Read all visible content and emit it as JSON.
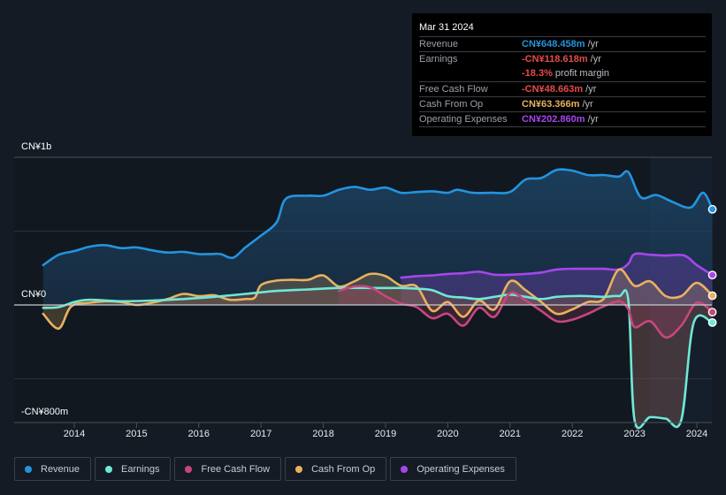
{
  "tooltip": {
    "date": "Mar 31 2024",
    "rows": [
      {
        "label": "Revenue",
        "value": "CN¥648.458m",
        "unit": " /yr",
        "color": "#2394df"
      },
      {
        "label": "Earnings",
        "value": "-CN¥118.618m",
        "unit": " /yr",
        "color": "#e64b4b"
      },
      {
        "label": "",
        "value": "-18.3%",
        "unit": " profit margin",
        "color": "#e64b4b"
      },
      {
        "label": "Free Cash Flow",
        "value": "-CN¥48.663m",
        "unit": " /yr",
        "color": "#e64b4b"
      },
      {
        "label": "Cash From Op",
        "value": "CN¥63.366m",
        "unit": " /yr",
        "color": "#e9b15f"
      },
      {
        "label": "Operating Expenses",
        "value": "CN¥202.860m",
        "unit": " /yr",
        "color": "#a745ee"
      }
    ]
  },
  "legend": [
    {
      "label": "Revenue",
      "color": "#2394df"
    },
    {
      "label": "Earnings",
      "color": "#6ee8d6"
    },
    {
      "label": "Free Cash Flow",
      "color": "#c8467e"
    },
    {
      "label": "Cash From Op",
      "color": "#e9b15f"
    },
    {
      "label": "Operating Expenses",
      "color": "#a745ee"
    }
  ],
  "chart_data": {
    "type": "line",
    "title": "",
    "xlabel": "",
    "ylabel": "",
    "y_tick_labels": [
      "CN¥1b",
      "CN¥0",
      "-CN¥800m"
    ],
    "x_tick_labels": [
      "2014",
      "2015",
      "2016",
      "2017",
      "2018",
      "2019",
      "2020",
      "2021",
      "2022",
      "2023",
      "2024"
    ],
    "xlim": [
      2013.5,
      2024.25
    ],
    "ylim": [
      -800,
      1000
    ],
    "units": "CN¥m",
    "grid": true,
    "legend_position": "bottom",
    "highlight_from": 2023.25,
    "series": [
      {
        "name": "Revenue",
        "color": "#2394df",
        "points": [
          [
            2013.5,
            270
          ],
          [
            2013.75,
            340
          ],
          [
            2014.0,
            365
          ],
          [
            2014.25,
            395
          ],
          [
            2014.5,
            405
          ],
          [
            2014.75,
            385
          ],
          [
            2015.0,
            390
          ],
          [
            2015.25,
            370
          ],
          [
            2015.5,
            355
          ],
          [
            2015.75,
            360
          ],
          [
            2016.0,
            345
          ],
          [
            2016.2,
            345
          ],
          [
            2016.35,
            345
          ],
          [
            2016.55,
            320
          ],
          [
            2016.75,
            390
          ],
          [
            2017.0,
            470
          ],
          [
            2017.25,
            560
          ],
          [
            2017.4,
            720
          ],
          [
            2017.75,
            740
          ],
          [
            2018.0,
            740
          ],
          [
            2018.25,
            780
          ],
          [
            2018.5,
            800
          ],
          [
            2018.75,
            780
          ],
          [
            2019.0,
            795
          ],
          [
            2019.25,
            760
          ],
          [
            2019.5,
            765
          ],
          [
            2019.75,
            770
          ],
          [
            2020.0,
            760
          ],
          [
            2020.15,
            780
          ],
          [
            2020.4,
            760
          ],
          [
            2020.7,
            760
          ],
          [
            2021.0,
            765
          ],
          [
            2021.25,
            850
          ],
          [
            2021.5,
            860
          ],
          [
            2021.75,
            915
          ],
          [
            2022.0,
            910
          ],
          [
            2022.25,
            880
          ],
          [
            2022.5,
            880
          ],
          [
            2022.75,
            870
          ],
          [
            2022.9,
            900
          ],
          [
            2023.1,
            730
          ],
          [
            2023.35,
            745
          ],
          [
            2023.6,
            700
          ],
          [
            2023.9,
            660
          ],
          [
            2024.1,
            760
          ],
          [
            2024.25,
            648
          ]
        ]
      },
      {
        "name": "Operating Expenses",
        "color": "#a745ee",
        "points": [
          [
            2019.25,
            185
          ],
          [
            2019.5,
            195
          ],
          [
            2019.75,
            200
          ],
          [
            2020.0,
            210
          ],
          [
            2020.25,
            215
          ],
          [
            2020.5,
            225
          ],
          [
            2020.75,
            205
          ],
          [
            2021.0,
            205
          ],
          [
            2021.25,
            210
          ],
          [
            2021.5,
            220
          ],
          [
            2021.75,
            240
          ],
          [
            2022.0,
            245
          ],
          [
            2022.25,
            245
          ],
          [
            2022.5,
            245
          ],
          [
            2022.75,
            240
          ],
          [
            2022.9,
            280
          ],
          [
            2023.0,
            345
          ],
          [
            2023.25,
            340
          ],
          [
            2023.5,
            335
          ],
          [
            2023.8,
            335
          ],
          [
            2024.0,
            270
          ],
          [
            2024.25,
            203
          ]
        ]
      },
      {
        "name": "Cash From Op",
        "color": "#e9b15f",
        "points": [
          [
            2013.5,
            -60
          ],
          [
            2013.75,
            -160
          ],
          [
            2013.95,
            -10
          ],
          [
            2014.25,
            15
          ],
          [
            2014.5,
            25
          ],
          [
            2014.75,
            20
          ],
          [
            2015.0,
            0
          ],
          [
            2015.25,
            15
          ],
          [
            2015.5,
            40
          ],
          [
            2015.75,
            75
          ],
          [
            2016.0,
            60
          ],
          [
            2016.25,
            65
          ],
          [
            2016.5,
            35
          ],
          [
            2016.75,
            40
          ],
          [
            2016.9,
            50
          ],
          [
            2017.0,
            135
          ],
          [
            2017.25,
            165
          ],
          [
            2017.5,
            170
          ],
          [
            2017.75,
            170
          ],
          [
            2018.0,
            200
          ],
          [
            2018.25,
            125
          ],
          [
            2018.5,
            160
          ],
          [
            2018.75,
            210
          ],
          [
            2019.0,
            195
          ],
          [
            2019.25,
            130
          ],
          [
            2019.5,
            125
          ],
          [
            2019.75,
            -40
          ],
          [
            2020.0,
            20
          ],
          [
            2020.25,
            -80
          ],
          [
            2020.5,
            30
          ],
          [
            2020.75,
            -30
          ],
          [
            2021.0,
            160
          ],
          [
            2021.25,
            100
          ],
          [
            2021.5,
            20
          ],
          [
            2021.75,
            -60
          ],
          [
            2022.0,
            -30
          ],
          [
            2022.25,
            20
          ],
          [
            2022.5,
            40
          ],
          [
            2022.75,
            240
          ],
          [
            2023.0,
            130
          ],
          [
            2023.25,
            160
          ],
          [
            2023.5,
            60
          ],
          [
            2023.75,
            60
          ],
          [
            2024.0,
            150
          ],
          [
            2024.25,
            63
          ]
        ]
      },
      {
        "name": "Earnings",
        "color": "#6ee8d6",
        "points": [
          [
            2013.5,
            -20
          ],
          [
            2013.75,
            -15
          ],
          [
            2014.0,
            20
          ],
          [
            2014.25,
            35
          ],
          [
            2014.75,
            25
          ],
          [
            2015.25,
            30
          ],
          [
            2015.75,
            40
          ],
          [
            2016.25,
            55
          ],
          [
            2016.75,
            75
          ],
          [
            2017.25,
            95
          ],
          [
            2017.75,
            105
          ],
          [
            2018.25,
            115
          ],
          [
            2018.75,
            115
          ],
          [
            2019.0,
            115
          ],
          [
            2019.25,
            115
          ],
          [
            2019.5,
            110
          ],
          [
            2019.75,
            100
          ],
          [
            2020.0,
            60
          ],
          [
            2020.25,
            50
          ],
          [
            2020.5,
            40
          ],
          [
            2020.75,
            55
          ],
          [
            2021.0,
            70
          ],
          [
            2021.25,
            55
          ],
          [
            2021.5,
            40
          ],
          [
            2021.75,
            55
          ],
          [
            2022.0,
            60
          ],
          [
            2022.25,
            60
          ],
          [
            2022.5,
            55
          ],
          [
            2022.75,
            60
          ],
          [
            2022.9,
            30
          ],
          [
            2023.0,
            -780
          ],
          [
            2023.25,
            -760
          ],
          [
            2023.5,
            -770
          ],
          [
            2023.75,
            -780
          ],
          [
            2023.95,
            -120
          ],
          [
            2024.25,
            -119
          ]
        ]
      },
      {
        "name": "Free Cash Flow",
        "color": "#c8467e",
        "points": [
          [
            2018.25,
            95
          ],
          [
            2018.5,
            125
          ],
          [
            2018.75,
            120
          ],
          [
            2019.0,
            60
          ],
          [
            2019.25,
            10
          ],
          [
            2019.5,
            -15
          ],
          [
            2019.75,
            -90
          ],
          [
            2020.0,
            -60
          ],
          [
            2020.25,
            -140
          ],
          [
            2020.5,
            -20
          ],
          [
            2020.75,
            -80
          ],
          [
            2021.0,
            80
          ],
          [
            2021.25,
            30
          ],
          [
            2021.5,
            -40
          ],
          [
            2021.75,
            -110
          ],
          [
            2022.0,
            -100
          ],
          [
            2022.25,
            -60
          ],
          [
            2022.5,
            -10
          ],
          [
            2022.75,
            25
          ],
          [
            2022.9,
            -30
          ],
          [
            2023.0,
            -150
          ],
          [
            2023.25,
            -110
          ],
          [
            2023.5,
            -220
          ],
          [
            2023.75,
            -140
          ],
          [
            2024.0,
            15
          ],
          [
            2024.25,
            -49
          ]
        ]
      }
    ]
  }
}
